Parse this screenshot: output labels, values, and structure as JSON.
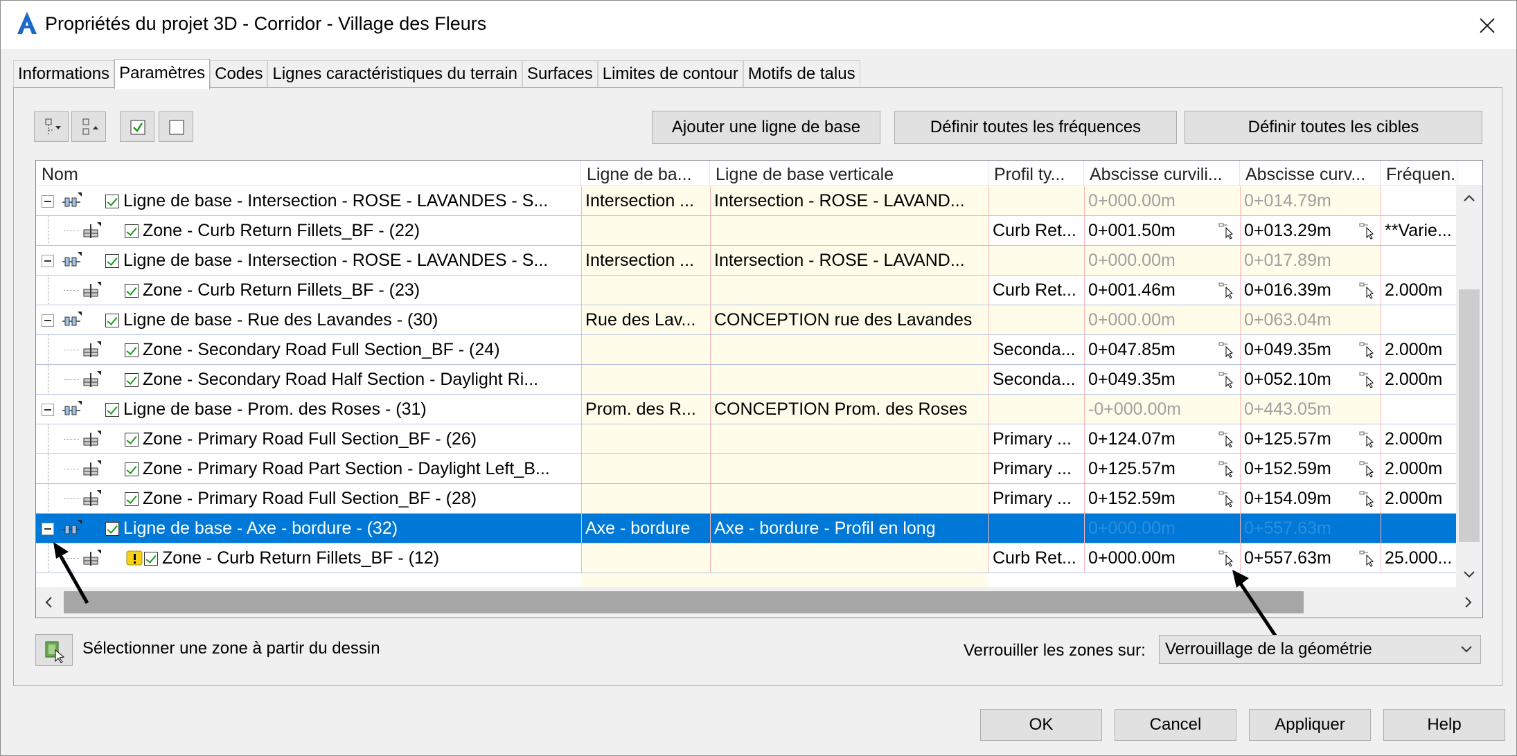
{
  "window": {
    "title": "Propriétés du projet 3D - Corridor - Village des Fleurs"
  },
  "tabs": [
    {
      "label": "Informations"
    },
    {
      "label": "Paramètres"
    },
    {
      "label": "Codes"
    },
    {
      "label": "Lignes caractéristiques du terrain"
    },
    {
      "label": "Surfaces"
    },
    {
      "label": "Limites de contour"
    },
    {
      "label": "Motifs de talus"
    }
  ],
  "active_tab": "Paramètres",
  "toolbar": {
    "add_baseline": "Ajouter une ligne de base",
    "set_all_frequencies": "Définir toutes les fréquences",
    "set_all_targets": "Définir toutes les cibles"
  },
  "columns": [
    "Nom",
    "Ligne de ba...",
    "Ligne de base verticale",
    "Profil ty...",
    "Abscisse curvili...",
    "Abscisse curv...",
    "Fréquen..."
  ],
  "rows": [
    {
      "level": 0,
      "name": "Ligne de base - Intersection - ROSE - LAVANDES - S...",
      "baseline": "Intersection ...",
      "vertical": "Intersection - ROSE - LAVAND...",
      "assembly": "",
      "start": "0+000.00m",
      "end": "0+014.79m",
      "freq": ""
    },
    {
      "level": 1,
      "name": "Zone - Curb Return Fillets_BF - (22)",
      "baseline": "",
      "vertical": "",
      "assembly": "Curb Ret...",
      "start": "0+001.50m",
      "end": "0+013.29m",
      "freq": "**Varie..."
    },
    {
      "level": 0,
      "name": "Ligne de base - Intersection - ROSE - LAVANDES - S...",
      "baseline": "Intersection ...",
      "vertical": "Intersection - ROSE - LAVAND...",
      "assembly": "",
      "start": "0+000.00m",
      "end": "0+017.89m",
      "freq": ""
    },
    {
      "level": 1,
      "name": "Zone - Curb Return Fillets_BF - (23)",
      "baseline": "",
      "vertical": "",
      "assembly": "Curb Ret...",
      "start": "0+001.46m",
      "end": "0+016.39m",
      "freq": "2.000m"
    },
    {
      "level": 0,
      "name": "Ligne de base - Rue des Lavandes - (30)",
      "baseline": "Rue des Lav...",
      "vertical": "CONCEPTION rue des Lavandes",
      "assembly": "",
      "start": "0+000.00m",
      "end": "0+063.04m",
      "freq": ""
    },
    {
      "level": 1,
      "name": "Zone - Secondary Road Full Section_BF - (24)",
      "baseline": "",
      "vertical": "",
      "assembly": "Seconda...",
      "start": "0+047.85m",
      "end": "0+049.35m",
      "freq": "2.000m"
    },
    {
      "level": 1,
      "name": "Zone - Secondary Road Half Section - Daylight Ri...",
      "baseline": "",
      "vertical": "",
      "assembly": "Seconda...",
      "start": "0+049.35m",
      "end": "0+052.10m",
      "freq": "2.000m"
    },
    {
      "level": 0,
      "name": "Ligne de base - Prom. des Roses - (31)",
      "baseline": "Prom. des R...",
      "vertical": "CONCEPTION Prom. des Roses",
      "assembly": "",
      "start": "-0+000.00m",
      "end": "0+443.05m",
      "freq": ""
    },
    {
      "level": 1,
      "name": "Zone - Primary Road Full Section_BF - (26)",
      "baseline": "",
      "vertical": "",
      "assembly": "Primary ...",
      "start": "0+124.07m",
      "end": "0+125.57m",
      "freq": "2.000m"
    },
    {
      "level": 1,
      "name": "Zone - Primary Road Part Section - Daylight Left_B...",
      "baseline": "",
      "vertical": "",
      "assembly": "Primary ...",
      "start": "0+125.57m",
      "end": "0+152.59m",
      "freq": "2.000m"
    },
    {
      "level": 1,
      "name": "Zone - Primary Road Full Section_BF - (28)",
      "baseline": "",
      "vertical": "",
      "assembly": "Primary ...",
      "start": "0+152.59m",
      "end": "0+154.09m",
      "freq": "2.000m"
    },
    {
      "level": 0,
      "name": "Ligne de base - Axe - bordure - (32)",
      "baseline": "Axe - bordure",
      "vertical": "Axe - bordure - Profil en long",
      "assembly": "",
      "start": "0+000.00m",
      "end": "0+557.63m",
      "freq": "",
      "selected": true
    },
    {
      "level": 1,
      "name": "Zone - Curb Return Fillets_BF - (12)",
      "baseline": "",
      "vertical": "",
      "assembly": "Curb Ret...",
      "start": "0+000.00m",
      "end": "0+557.63m",
      "freq": "25.000...",
      "warning": true
    }
  ],
  "footer": {
    "select_zone_label": "Sélectionner une zone à partir du dessin",
    "lock_label": "Verrouiller les zones sur:",
    "lock_value": "Verrouillage de la géométrie"
  },
  "buttons": {
    "ok": "OK",
    "cancel": "Cancel",
    "apply": "Appliquer",
    "help": "Help"
  },
  "colors": {
    "selection": "#0078d7",
    "cell_yellow": "#fffcea",
    "check_green": "#1a9a1a"
  },
  "icons": [
    "autocad-civil-icon",
    "close-icon",
    "expand-all-icon",
    "collapse-all-icon",
    "check-all-icon",
    "uncheck-all-icon",
    "baseline-icon",
    "region-icon",
    "pick-station-icon",
    "warning-icon",
    "select-from-drawing-icon",
    "chevron-down-icon"
  ]
}
